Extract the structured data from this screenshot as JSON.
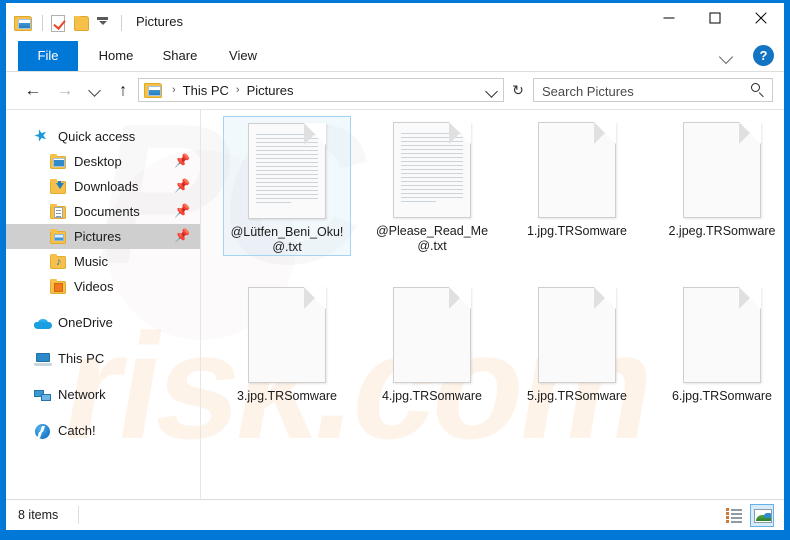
{
  "window": {
    "title": "Pictures",
    "quick_access_toolbar": [
      {
        "name": "pictures-folder-icon",
        "label": "Pictures"
      },
      {
        "name": "properties-icon",
        "label": "Properties"
      },
      {
        "name": "new-folder-icon",
        "label": "New folder"
      },
      {
        "name": "customize-qat-icon",
        "label": "Customize Quick Access Toolbar"
      }
    ],
    "controls": {
      "minimize": "–",
      "maximize": "□",
      "close": "×"
    }
  },
  "ribbon": {
    "tabs": [
      {
        "label": "File",
        "active": true
      },
      {
        "label": "Home",
        "active": false
      },
      {
        "label": "Share",
        "active": false
      },
      {
        "label": "View",
        "active": false
      }
    ],
    "collapse_icon": "chevron-down-icon",
    "help_label": "?"
  },
  "address_bar": {
    "back_icon": "←",
    "forward_icon": "→",
    "recent_icon": "chevron-down-icon",
    "up_icon": "↑",
    "breadcrumb": {
      "icon": "pictures-folder-icon",
      "items": [
        "This PC",
        "Pictures"
      ],
      "separator": "›"
    },
    "refresh_icon": "↻"
  },
  "search": {
    "placeholder": "Search Pictures",
    "value": "",
    "icon": "search-icon"
  },
  "sidebar": {
    "items": [
      {
        "label": "Quick access",
        "icon": "star-icon",
        "level": 0,
        "selected": false,
        "pinned": false
      },
      {
        "label": "Desktop",
        "icon": "desktop-folder-icon",
        "level": 1,
        "selected": false,
        "pinned": true
      },
      {
        "label": "Downloads",
        "icon": "downloads-folder-icon",
        "level": 1,
        "selected": false,
        "pinned": true
      },
      {
        "label": "Documents",
        "icon": "documents-folder-icon",
        "level": 1,
        "selected": false,
        "pinned": true
      },
      {
        "label": "Pictures",
        "icon": "pictures-folder-icon",
        "level": 1,
        "selected": true,
        "pinned": true
      },
      {
        "label": "Music",
        "icon": "music-folder-icon",
        "level": 1,
        "selected": false,
        "pinned": false
      },
      {
        "label": "Videos",
        "icon": "videos-folder-icon",
        "level": 1,
        "selected": false,
        "pinned": false
      },
      {
        "label": "OneDrive",
        "icon": "onedrive-icon",
        "level": 0,
        "selected": false,
        "pinned": false
      },
      {
        "label": "This PC",
        "icon": "this-pc-icon",
        "level": 0,
        "selected": false,
        "pinned": false
      },
      {
        "label": "Network",
        "icon": "network-icon",
        "level": 0,
        "selected": false,
        "pinned": false
      },
      {
        "label": "Catch!",
        "icon": "catch-icon",
        "level": 0,
        "selected": false,
        "pinned": false
      }
    ],
    "pin_glyph": "📌"
  },
  "files": [
    {
      "name": "@Lütfen_Beni_Oku!@.txt",
      "icon": "text-file-icon",
      "selected": true
    },
    {
      "name": "@Please_Read_Me@.txt",
      "icon": "text-file-icon",
      "selected": false
    },
    {
      "name": "1.jpg.TRSomware",
      "icon": "blank-file-icon",
      "selected": false
    },
    {
      "name": "2.jpeg.TRSomware",
      "icon": "blank-file-icon",
      "selected": false
    },
    {
      "name": "3.jpg.TRSomware",
      "icon": "blank-file-icon",
      "selected": false
    },
    {
      "name": "4.jpg.TRSomware",
      "icon": "blank-file-icon",
      "selected": false
    },
    {
      "name": "5.jpg.TRSomware",
      "icon": "blank-file-icon",
      "selected": false
    },
    {
      "name": "6.jpg.TRSomware",
      "icon": "blank-file-icon",
      "selected": false
    }
  ],
  "status_bar": {
    "item_count": "8 items",
    "view_buttons": [
      {
        "name": "details-view-button",
        "active": false
      },
      {
        "name": "large-icons-view-button",
        "active": true
      }
    ]
  },
  "watermark": {
    "text_top": "PC",
    "text_bottom": "risk.com"
  },
  "colors": {
    "accent": "#0078d7",
    "selection_border": "#a5d3f2",
    "sidebar_selected": "#cfcfcf",
    "folder_yellow": "#f7c04a"
  }
}
